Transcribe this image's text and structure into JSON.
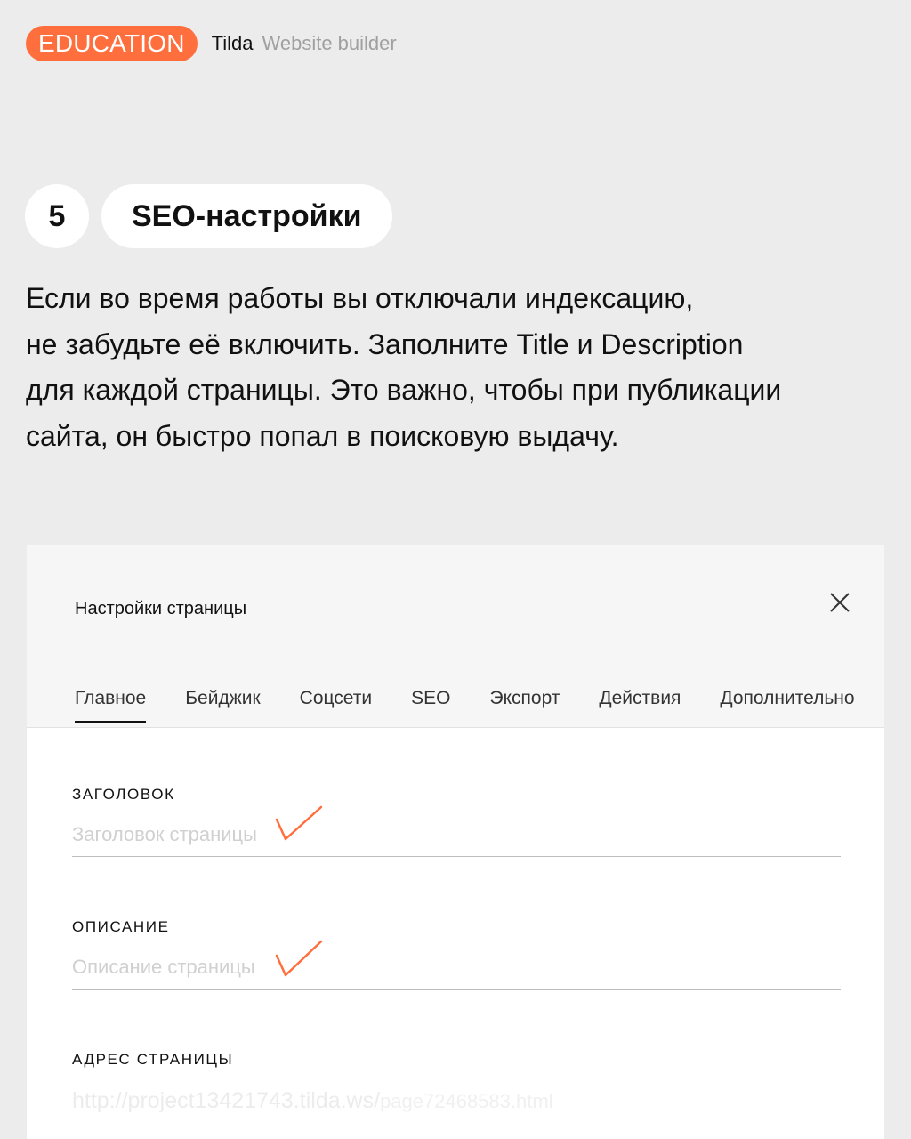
{
  "header": {
    "badge": "EDUCATION",
    "brand": "Tilda",
    "brand_sub": "Website builder"
  },
  "step": {
    "number": "5",
    "title": "SEO-настройки"
  },
  "intro": {
    "lines": [
      "Если во время работы вы отключали индексацию,",
      "не забудьте её включить. Заполните Title и Description",
      "для каждой страницы. Это важно, чтобы при публикации",
      "сайта, он быстро попал в поисковую выдачу."
    ]
  },
  "panel": {
    "title": "Настройки страницы",
    "tabs": [
      {
        "label": "Главное",
        "active": true
      },
      {
        "label": "Бейджик",
        "active": false
      },
      {
        "label": "Соцсети",
        "active": false
      },
      {
        "label": "SEO",
        "active": false
      },
      {
        "label": "Экспорт",
        "active": false
      },
      {
        "label": "Действия",
        "active": false
      },
      {
        "label": "Дополнительно",
        "active": false
      }
    ],
    "fields": {
      "title": {
        "label": "ЗАГОЛОВОК",
        "placeholder": "Заголовок страницы",
        "value": ""
      },
      "description": {
        "label": "ОПИСАНИЕ",
        "placeholder": "Описание страницы",
        "value": ""
      },
      "address": {
        "label": "АДРЕС СТРАНИЦЫ",
        "base": "http://project13421743.tilda.ws/",
        "page": "page72468583.html"
      }
    }
  },
  "colors": {
    "accent": "#ff6f3d",
    "background": "#ececec"
  }
}
